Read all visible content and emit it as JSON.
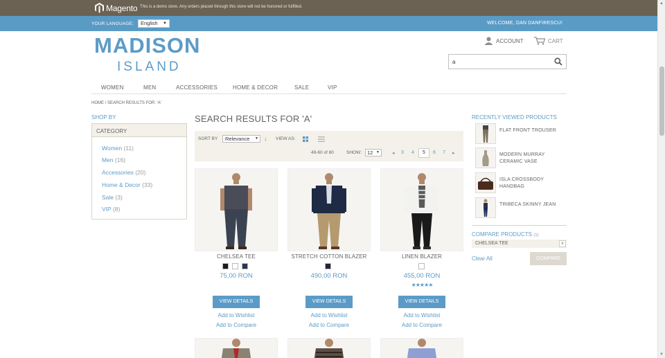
{
  "notice": {
    "logo_text": "Magento",
    "message": "This is a demo store. Any orders placed through this store will not be honored or fulfilled."
  },
  "langbar": {
    "label": "YOUR LANGUAGE:",
    "language": "English",
    "welcome": "WELCOME, DAN DANFIRESCU!"
  },
  "brand": {
    "line1": "MADISON",
    "line2": "ISLAND"
  },
  "header": {
    "account": "ACCOUNT",
    "cart": "CART",
    "search_value": "a"
  },
  "nav": [
    "WOMEN",
    "MEN",
    "ACCESSORIES",
    "HOME & DECOR",
    "SALE",
    "VIP"
  ],
  "breadcrumb": "HOME  /  SEARCH RESULTS FOR: 'A'",
  "sidebar": {
    "shop_by": "SHOP BY",
    "category_head": "CATEGORY",
    "categories": [
      {
        "name": "Women",
        "count": "(11)"
      },
      {
        "name": "Men",
        "count": "(16)"
      },
      {
        "name": "Accessories",
        "count": "(20)"
      },
      {
        "name": "Home & Decor",
        "count": "(33)"
      },
      {
        "name": "Sale",
        "count": "(3)"
      },
      {
        "name": "VIP",
        "count": "(8)"
      }
    ]
  },
  "main": {
    "title": "SEARCH RESULTS FOR 'A'",
    "toolbar": {
      "sort_by": "SORT BY",
      "sort_value": "Relevance",
      "view_as": "VIEW AS:",
      "range": "49-60 of 80",
      "show": "SHOW:",
      "show_value": "12",
      "pages": [
        "3",
        "4",
        "5",
        "6",
        "7"
      ],
      "current_page": "5"
    },
    "products": [
      {
        "name": "CHELSEA TEE",
        "price": "75,00 RON",
        "swatches": [
          "#1b1b1b",
          "#ffffff",
          "#2c3556"
        ],
        "details": "VIEW DETAILS",
        "wishlist": "Add to Wishlist",
        "compare": "Add to Compare",
        "rating": ""
      },
      {
        "name": "STRETCH COTTON BLAZER",
        "price": "490,00 RON",
        "swatches": [
          "#22263a"
        ],
        "details": "VIEW DETAILS",
        "wishlist": "Add to Wishlist",
        "compare": "Add to Compare",
        "rating": ""
      },
      {
        "name": "LINEN BLAZER",
        "price": "455,00 RON",
        "swatches": [
          "#ffffff"
        ],
        "details": "VIEW DETAILS",
        "wishlist": "Add to Wishlist",
        "compare": "Add to Compare",
        "rating": "★★★★★"
      }
    ]
  },
  "right": {
    "recent_title": "RECENTLY VIEWED PRODUCTS",
    "recent": [
      "FLAT FRONT TROUSER",
      "MODERN MURRAY CERAMIC VASE",
      "ISLA CROSSBODY HANDBAG",
      "TRIBECA SKINNY JEAN"
    ],
    "compare_title": "COMPARE PRODUCTS",
    "compare_count": "(1)",
    "compare_item": "CHELSEA TEE",
    "compare_remove": "x",
    "clear_all": "Clear All",
    "compare_button": "COMPARE"
  },
  "colors": {
    "accent": "#5c9bc7",
    "notice_bg": "#6b6253",
    "panel": "#f4f1ea"
  }
}
